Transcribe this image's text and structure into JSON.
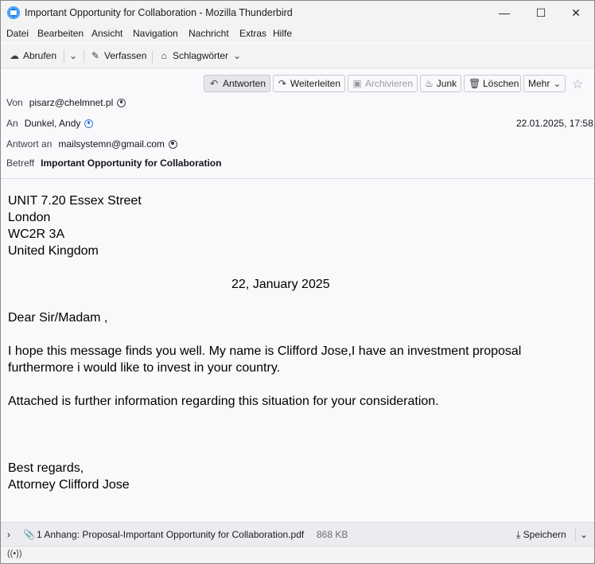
{
  "window": {
    "title": "Important Opportunity for Collaboration - Mozilla Thunderbird",
    "minimize": "—",
    "maximize": "☐",
    "close": "✕"
  },
  "menubar": [
    "Datei",
    "Bearbeiten",
    "Ansicht",
    "Navigation",
    "Nachricht",
    "Extras",
    "Hilfe"
  ],
  "toolbar": {
    "get_messages": "Abrufen",
    "compose": "Verfassen",
    "tags": "Schlagwörter"
  },
  "header_buttons": {
    "reply": "Antworten",
    "forward": "Weiterleiten",
    "archive": "Archivieren",
    "junk": "Junk",
    "delete": "Löschen",
    "more": "Mehr"
  },
  "headers": {
    "from_label": "Von",
    "from_value": "pisarz@chelmnet.pl",
    "to_label": "An",
    "to_value": "Dunkel, Andy",
    "date": "22.01.2025, 17:58",
    "reply_to_label": "Antwort an",
    "reply_to_value": "mailsystemn@gmail.com",
    "subject_label": "Betreff",
    "subject_value": "Important Opportunity for Collaboration"
  },
  "body": {
    "address_1": "UNIT 7.20  Essex Street",
    "address_2": "London",
    "address_3": "WC2R  3A",
    "address_4": "United Kingdom",
    "date_line": "22, January 2025",
    "greeting": "Dear Sir/Madam ,",
    "para_1_line_1": "I hope this message finds you well. My name is Clifford Jose,I have an investment proposal",
    "para_1_line_2": "furthermore i would like to invest in your country.",
    "para_2": "Attached is further information regarding this situation for your consideration.",
    "closing": "Best regards,",
    "signature": "Attorney Clifford Jose"
  },
  "attachment": {
    "label": "1 Anhang: Proposal-Important Opportunity for Collaboration.pdf",
    "size": "868 KB",
    "save": "Speichern"
  }
}
